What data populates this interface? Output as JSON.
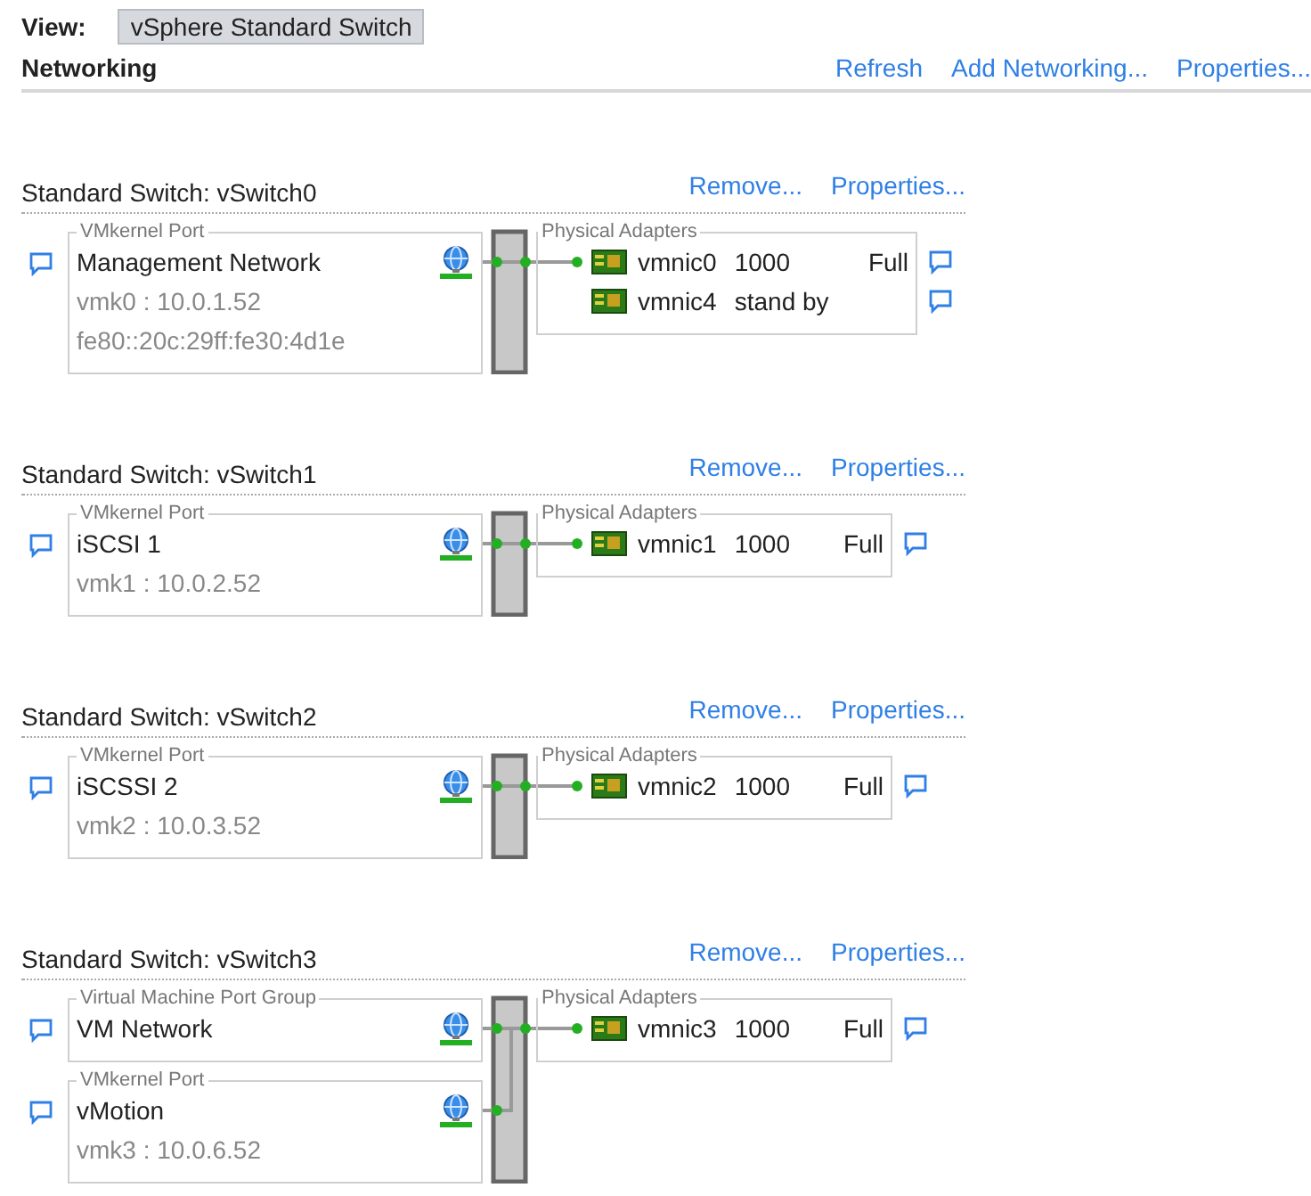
{
  "view": {
    "label": "View:",
    "value": "vSphere Standard Switch"
  },
  "networking": {
    "title": "Networking",
    "actions": [
      "Refresh",
      "Add Networking...",
      "Properties..."
    ]
  },
  "switches": [
    {
      "title": "Standard Switch: vSwitch0",
      "actions": [
        "Remove...",
        "Properties..."
      ],
      "port_groups": [
        {
          "type_label": "VMkernel Port",
          "name": "Management Network",
          "details": [
            "vmk0 : 10.0.1.52",
            "fe80::20c:29ff:fe30:4d1e"
          ]
        }
      ],
      "adapters_label": "Physical Adapters",
      "adapters": [
        {
          "name": "vmnic0",
          "speed": "1000",
          "duplex": "Full",
          "active": true
        },
        {
          "name": "vmnic4",
          "speed": "stand by",
          "active": false
        }
      ]
    },
    {
      "title": "Standard Switch: vSwitch1",
      "actions": [
        "Remove...",
        "Properties..."
      ],
      "port_groups": [
        {
          "type_label": "VMkernel Port",
          "name": "iSCSI 1",
          "details": [
            "vmk1 : 10.0.2.52"
          ]
        }
      ],
      "adapters_label": "Physical Adapters",
      "adapters": [
        {
          "name": "vmnic1",
          "speed": "1000",
          "duplex": "Full",
          "active": true
        }
      ]
    },
    {
      "title": "Standard Switch: vSwitch2",
      "actions": [
        "Remove...",
        "Properties..."
      ],
      "port_groups": [
        {
          "type_label": "VMkernel Port",
          "name": "iSCSSI 2",
          "details": [
            "vmk2 : 10.0.3.52"
          ]
        }
      ],
      "adapters_label": "Physical Adapters",
      "adapters": [
        {
          "name": "vmnic2",
          "speed": "1000",
          "duplex": "Full",
          "active": true
        }
      ]
    },
    {
      "title": "Standard Switch: vSwitch3",
      "actions": [
        "Remove...",
        "Properties..."
      ],
      "port_groups": [
        {
          "type_label": "Virtual Machine Port Group",
          "name": "VM Network"
        },
        {
          "type_label": "VMkernel Port",
          "name": "vMotion",
          "details": [
            "vmk3 : 10.0.6.52"
          ]
        }
      ],
      "adapters_label": "Physical Adapters",
      "adapters": [
        {
          "name": "vmnic3",
          "speed": "1000",
          "duplex": "Full",
          "active": true
        }
      ]
    }
  ]
}
